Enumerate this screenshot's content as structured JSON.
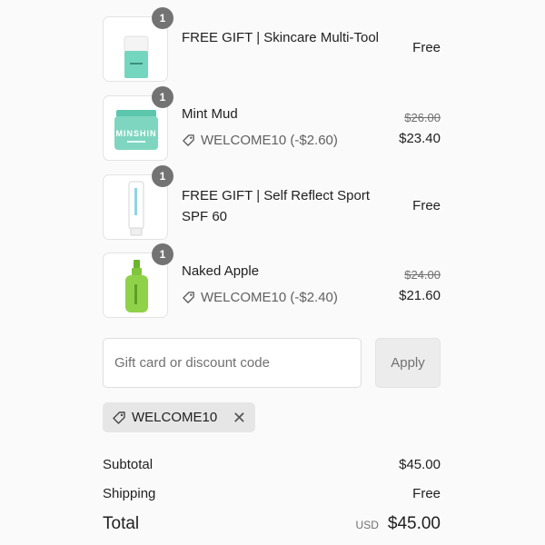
{
  "items": [
    {
      "title": "FREE GIFT | Skincare Multi-Tool",
      "quantity": "1",
      "price": "Free",
      "original_price": null,
      "discount": null,
      "thumb_icon": "multi-tool-product-image"
    },
    {
      "title": "Mint Mud",
      "quantity": "1",
      "price": "$23.40",
      "original_price": "$26.00",
      "discount": "WELCOME10 (-$2.60)",
      "thumb_icon": "mint-mud-jar-image",
      "thumb_text": "MINSHIN"
    },
    {
      "title": "FREE GIFT | Self Reflect Sport SPF 60",
      "quantity": "1",
      "price": "Free",
      "original_price": null,
      "discount": null,
      "thumb_icon": "spf-tube-image"
    },
    {
      "title": "Naked Apple",
      "quantity": "1",
      "price": "$21.60",
      "original_price": "$24.00",
      "discount": "WELCOME10 (-$2.40)",
      "thumb_icon": "naked-apple-bottle-image"
    }
  ],
  "discount_form": {
    "placeholder": "Gift card or discount code",
    "value": "",
    "apply_label": "Apply"
  },
  "applied_code": "WELCOME10",
  "totals": {
    "subtotal_label": "Subtotal",
    "subtotal_value": "$45.00",
    "shipping_label": "Shipping",
    "shipping_value": "Free",
    "total_label": "Total",
    "currency": "USD",
    "total_value": "$45.00"
  },
  "colors": {
    "mint": "#7fd6c0",
    "apple_green": "#8fd24a",
    "badge": "#737373"
  }
}
